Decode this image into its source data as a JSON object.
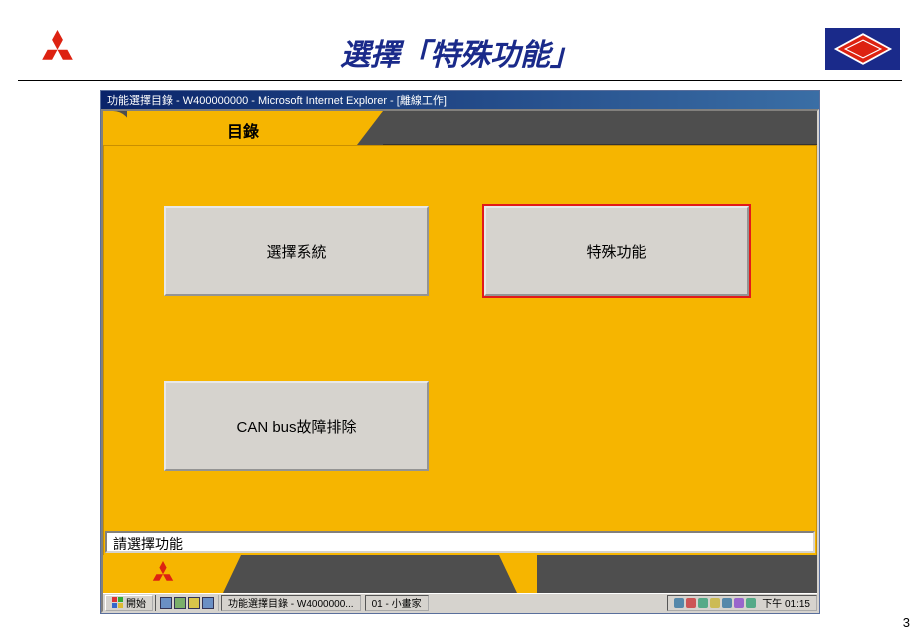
{
  "slide": {
    "title": "選擇「特殊功能」",
    "page_number": "3"
  },
  "window": {
    "title": "功能選擇目錄 - W400000000 - Microsoft Internet Explorer - [離線工作]"
  },
  "tabs": {
    "active_label": "目錄"
  },
  "content": {
    "buttons": [
      {
        "label": "選擇系統",
        "highlighted": false
      },
      {
        "label": "特殊功能",
        "highlighted": true
      },
      {
        "label": "CAN bus故障排除",
        "highlighted": false
      }
    ]
  },
  "status": {
    "text": "請選擇功能"
  },
  "taskbar": {
    "start": "開始",
    "items": [
      "功能選擇目錄 - W4000000...",
      "01 - 小畫家"
    ],
    "clock": "下午 01:15"
  },
  "icons": {
    "mitsubishi": "mitsubishi-logo",
    "red_diamond": "red-diamond-logo"
  }
}
